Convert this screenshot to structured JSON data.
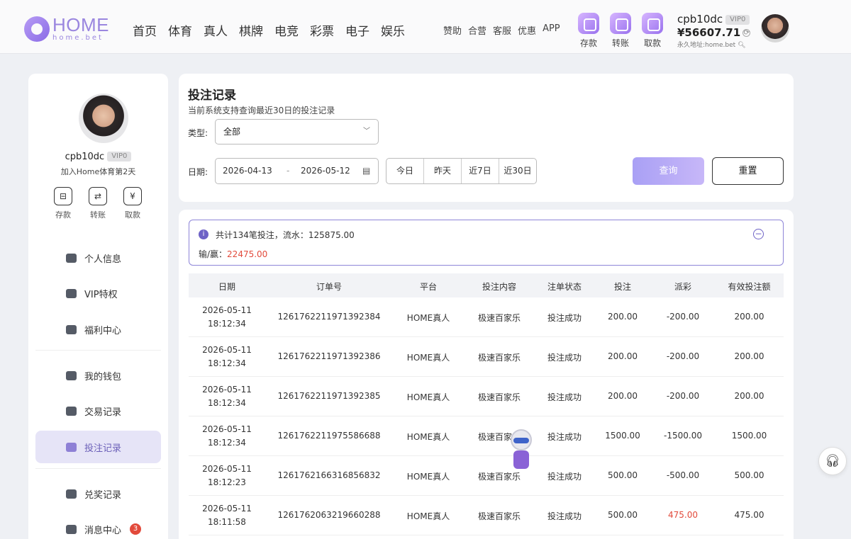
{
  "brand": {
    "logo_text": "HOME",
    "logo_sub": "home.bet"
  },
  "nav": {
    "main": [
      "首页",
      "体育",
      "真人",
      "棋牌",
      "电竞",
      "彩票",
      "电子",
      "娱乐"
    ],
    "secondary": [
      "赞助",
      "合营",
      "客服",
      "优惠",
      "APP"
    ],
    "quick_actions": [
      "存款",
      "转账",
      "取款"
    ]
  },
  "user": {
    "name": "cpb10dc",
    "vip": "VIP0",
    "balance": "¥56607.71",
    "address_note": "永久地址:home.bet",
    "days_note": "加入Home体育第2天"
  },
  "sidebar": {
    "actions": [
      "存款",
      "转账",
      "取款"
    ],
    "menu": [
      {
        "label": "个人信息",
        "icon": "id-card-icon"
      },
      {
        "label": "VIP特权",
        "icon": "crown-icon"
      },
      {
        "label": "福利中心",
        "icon": "ticket-icon"
      },
      {
        "label": "我的钱包",
        "icon": "wallet-icon"
      },
      {
        "label": "交易记录",
        "icon": "transaction-icon"
      },
      {
        "label": "投注记录",
        "icon": "bet-record-icon"
      },
      {
        "label": "兑奖记录",
        "icon": "gift-icon"
      },
      {
        "label": "消息中心",
        "icon": "bell-icon"
      }
    ],
    "message_count": "3"
  },
  "filter": {
    "title": "投注记录",
    "subtitle": "当前系统支持查询最近30日的投注记录",
    "type_label": "类型:",
    "type_value": "全部",
    "date_label": "日期:",
    "date_start": "2026-04-13",
    "date_sep": "-",
    "date_end": "2026-05-12",
    "quick_ranges": [
      "今日",
      "昨天",
      "近7日",
      "近30日"
    ],
    "query_label": "查询",
    "reset_label": "重置"
  },
  "summary": {
    "line1": "共计134笔投注，流水：125875.00",
    "winloss_label": "输/赢：",
    "winloss_value": "22475.00"
  },
  "table": {
    "headers": [
      "日期",
      "订单号",
      "平台",
      "投注内容",
      "注单状态",
      "投注",
      "派彩",
      "有效投注额"
    ],
    "rows": [
      {
        "date": "2026-05-11",
        "time": "18:12:34",
        "order": "1261762211971392384",
        "platform": "HOME真人",
        "content": "极速百家乐",
        "status": "投注成功",
        "bet": "200.00",
        "payout": "-200.00",
        "valid": "200.00"
      },
      {
        "date": "2026-05-11",
        "time": "18:12:34",
        "order": "1261762211971392386",
        "platform": "HOME真人",
        "content": "极速百家乐",
        "status": "投注成功",
        "bet": "200.00",
        "payout": "-200.00",
        "valid": "200.00"
      },
      {
        "date": "2026-05-11",
        "time": "18:12:34",
        "order": "1261762211971392385",
        "platform": "HOME真人",
        "content": "极速百家乐",
        "status": "投注成功",
        "bet": "200.00",
        "payout": "-200.00",
        "valid": "200.00"
      },
      {
        "date": "2026-05-11",
        "time": "18:12:34",
        "order": "1261762211975586688",
        "platform": "HOME真人",
        "content": "极速百家乐",
        "status": "投注成功",
        "bet": "1500.00",
        "payout": "-1500.00",
        "valid": "1500.00"
      },
      {
        "date": "2026-05-11",
        "time": "18:12:23",
        "order": "1261762166316856832",
        "platform": "HOME真人",
        "content": "极速百家乐",
        "status": "投注成功",
        "bet": "500.00",
        "payout": "-500.00",
        "valid": "500.00"
      },
      {
        "date": "2026-05-11",
        "time": "18:11:58",
        "order": "1261762063219660288",
        "platform": "HOME真人",
        "content": "极速百家乐",
        "status": "投注成功",
        "bet": "500.00",
        "payout": "475.00",
        "valid": "475.00"
      }
    ]
  },
  "colors": {
    "accent": "#8e80d6",
    "negative_text": "#333333",
    "positive_text": "#e24a3b"
  }
}
